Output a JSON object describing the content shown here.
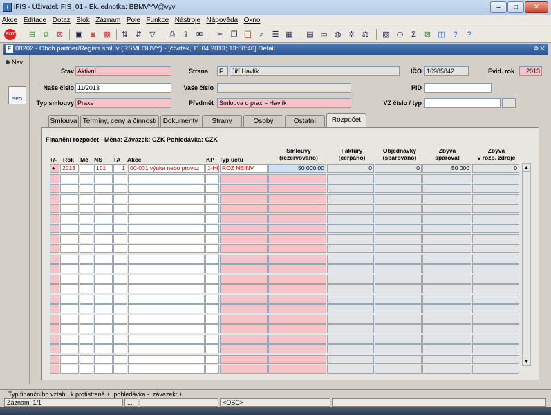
{
  "window": {
    "title": "iFIS - Uživatel: FIS_01 - Ek.jednotka: BBMVYV@vyv",
    "min": "–",
    "max": "□",
    "close": "✕"
  },
  "menu": [
    "Akce",
    "Editace",
    "Dotaz",
    "Blok",
    "Záznam",
    "Pole",
    "Funkce",
    "Nástroje",
    "Nápověda",
    "Okno"
  ],
  "inner_window": {
    "title": "08202 - Obch.partner/Registr smluv (RSMLOUVY) - [čtvrtek, 11.04.2013; 13:08:40] Detail",
    "controls": "⧉ ✕"
  },
  "left": {
    "nav": "Nav",
    "spg": "SPG"
  },
  "form": {
    "stav_label": "Stav",
    "stav": "Aktivní",
    "strana_label": "Strana",
    "strana_code": "F",
    "strana": "Jiří Havlík",
    "ico_label": "IČO",
    "ico": "16985842",
    "evid_label": "Evid. rok",
    "evid": "2013",
    "nase_label": "Naše číslo",
    "nase": "11/2013",
    "vase_label": "Vaše číslo",
    "vase": "",
    "pid_label": "PID",
    "pid": "",
    "typ_label": "Typ smlouvy",
    "typ": "Praxe",
    "predmet_label": "Předmět",
    "predmet": "Smlouva o praxi - Havlík",
    "vz_label": "VZ číslo / typ",
    "vz": "",
    "vz_typ": ""
  },
  "tabs": [
    "Smlouva",
    "Termíny, ceny a činnosti",
    "Dokumenty",
    "Strany",
    "Osoby",
    "Ostatní",
    "Rozpočet"
  ],
  "budget": {
    "heading": "Finanční rozpočet - Měna: Závazek: CZK Pohledávka: CZK",
    "columns": [
      "+/-",
      "Rok",
      "Mě",
      "NS",
      "TA",
      "Akce",
      "KP",
      "Typ účtu",
      "Smlouvy\n(rezervováno)",
      "Faktury\n(čerpáno)",
      "Objednávky\n(spárováno)",
      "Zbývá\nspárovat",
      "Zbývá\nv rozp. zdroje"
    ],
    "row1": {
      "sign": "+",
      "rok": "2013",
      "me": "",
      "ns": "101",
      "ta": "1",
      "akce": "00-001 výuka nebo provoz",
      "kp": "1-Hl",
      "typ": "ROZ NEINV",
      "smlouvy": "50 000.00",
      "faktury": "0",
      "objednavky": "0",
      "zbyva": "50 000",
      "zbyva_zdroj": "0"
    }
  },
  "status": {
    "message": "Typ finančního vztahu k protistraně +..pohledávka  -..závazek: +",
    "record": "Záznam: 1/1",
    "mid": "...",
    "osc": "<OSC>"
  }
}
